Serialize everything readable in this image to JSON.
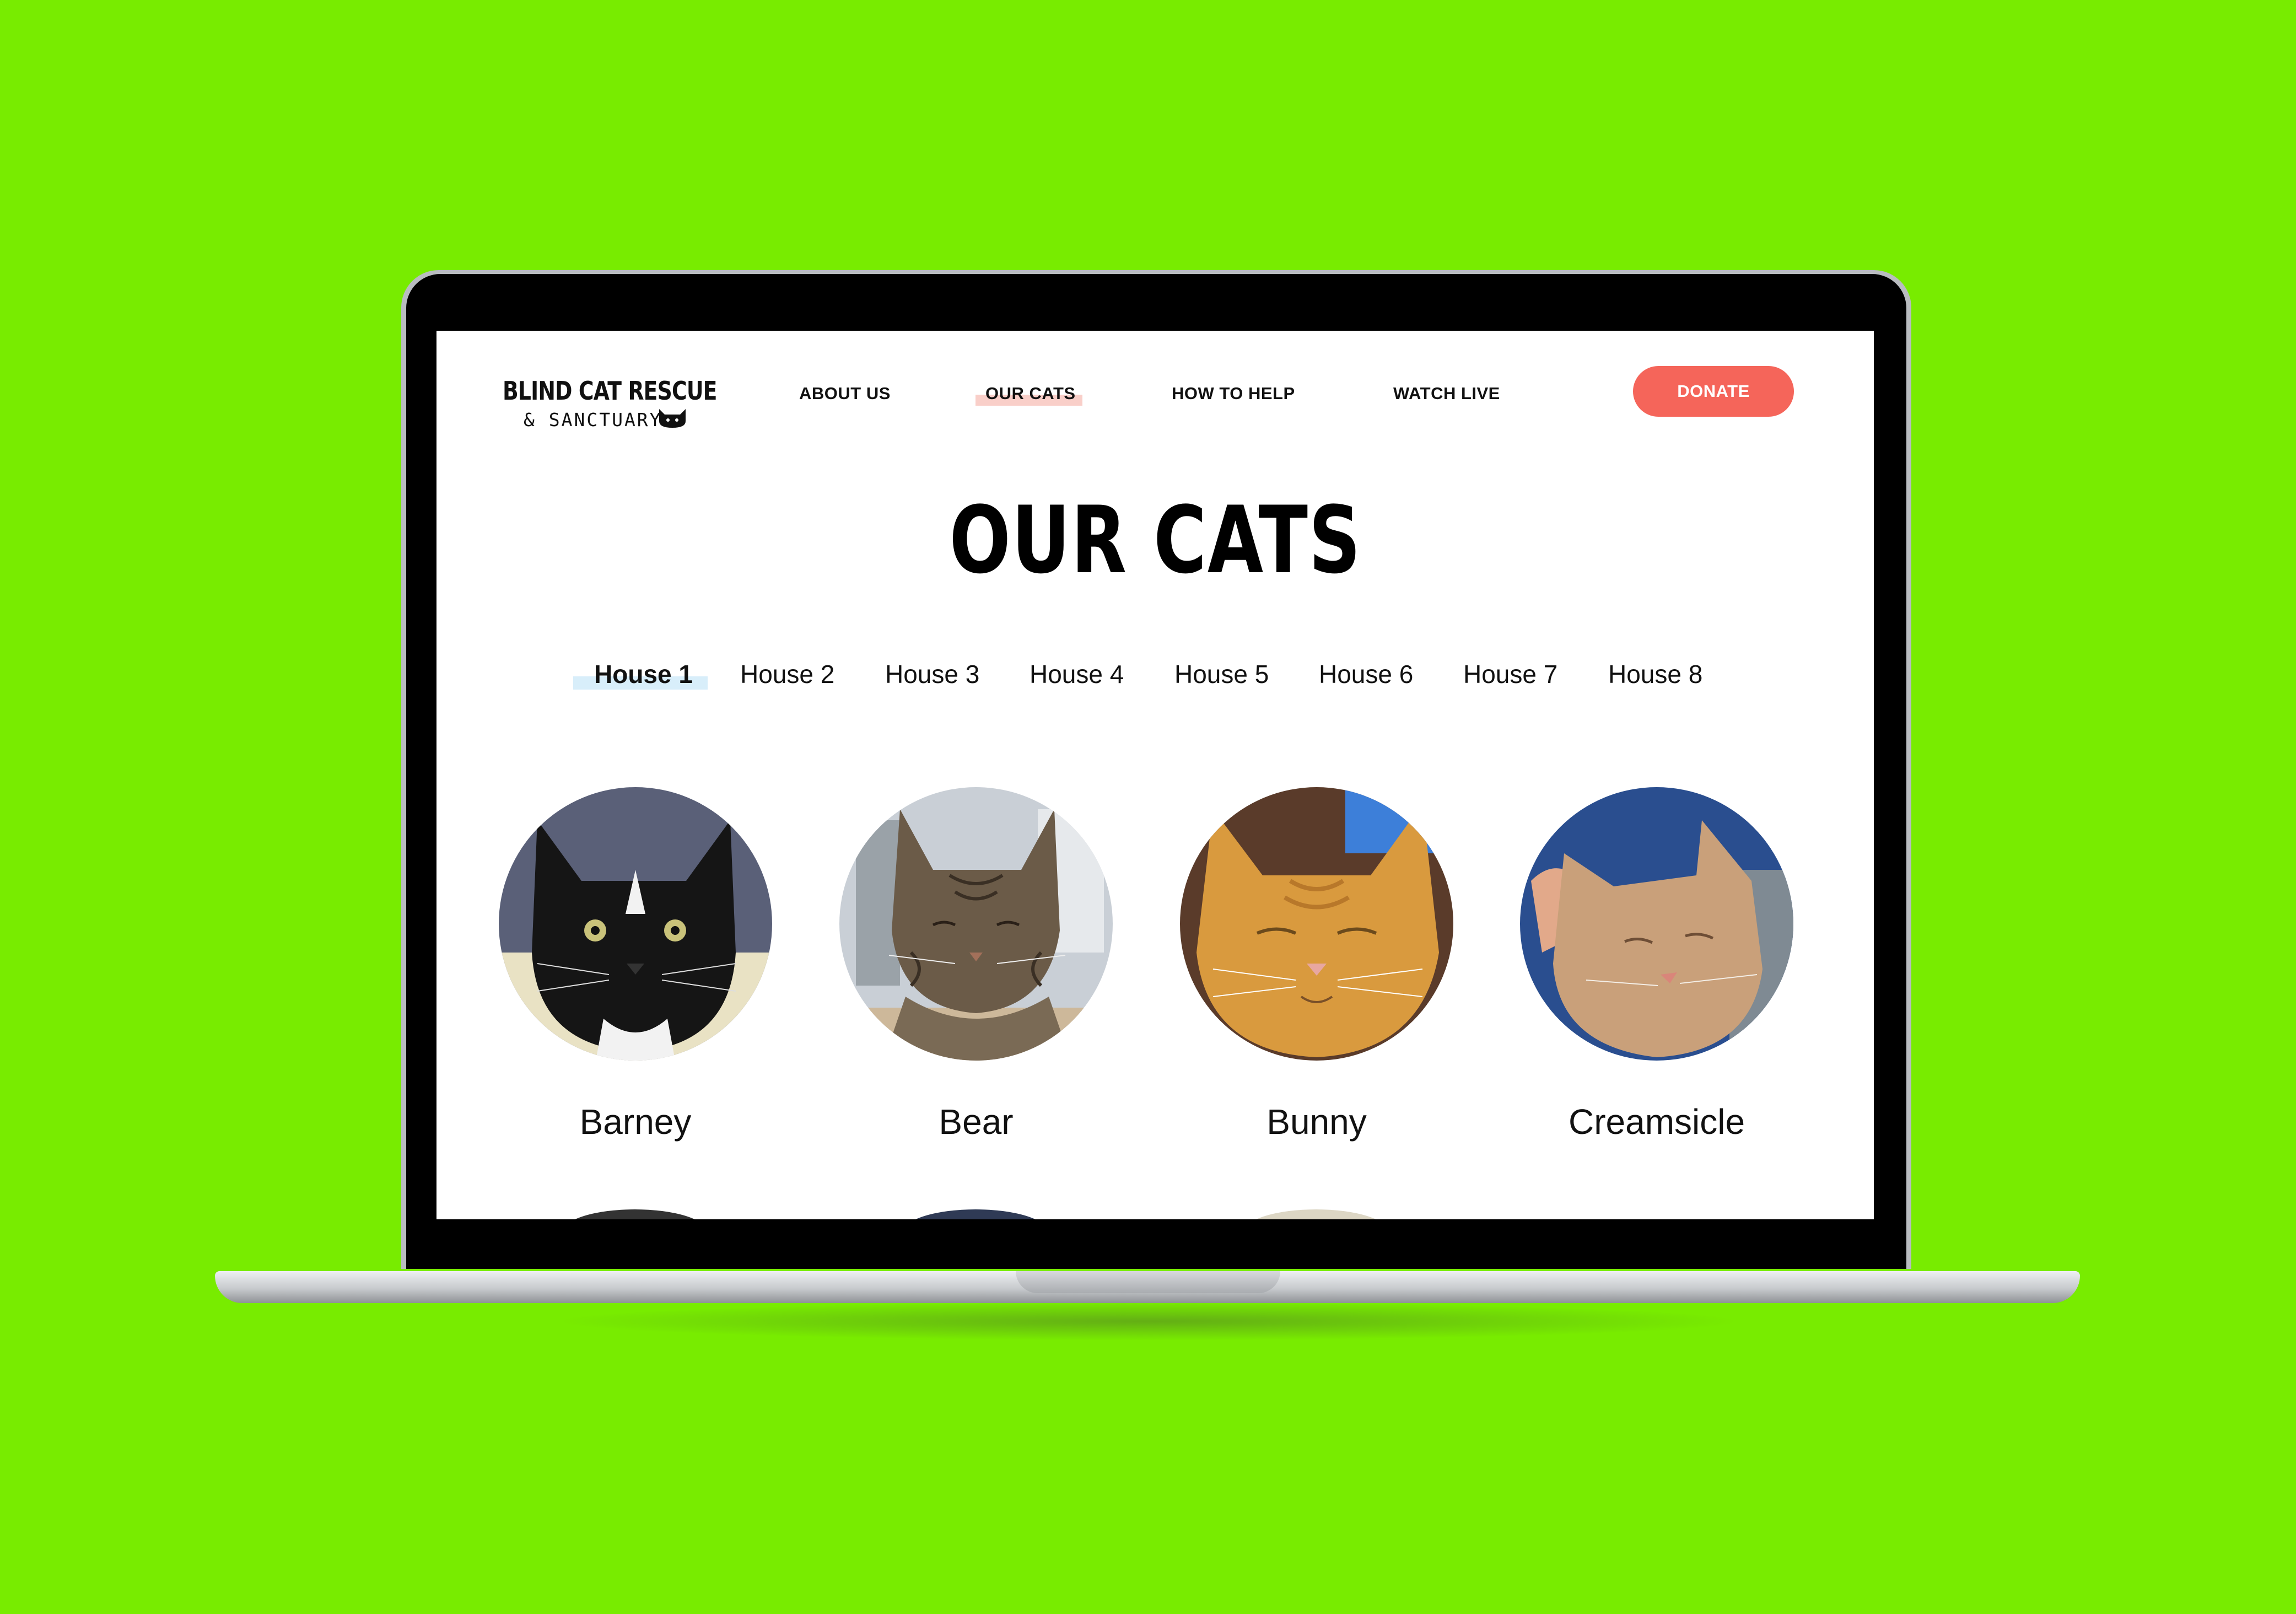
{
  "logo": {
    "title": "BLIND CAT RESCUE",
    "subtitle": "& SANCTUARY"
  },
  "nav": {
    "items": [
      {
        "label": "ABOUT US"
      },
      {
        "label": "OUR CATS"
      },
      {
        "label": "HOW TO HELP"
      },
      {
        "label": "WATCH LIVE"
      }
    ],
    "donate_label": "DONATE"
  },
  "page": {
    "title": "OUR CATS"
  },
  "tabs": [
    {
      "label": "House 1",
      "active": true
    },
    {
      "label": "House 2"
    },
    {
      "label": "House 3"
    },
    {
      "label": "House 4"
    },
    {
      "label": "House 5"
    },
    {
      "label": "House 6"
    },
    {
      "label": "House 7"
    },
    {
      "label": "House 8"
    }
  ],
  "cats": [
    {
      "name": "Barney"
    },
    {
      "name": "Bear"
    },
    {
      "name": "Bunny"
    },
    {
      "name": "Creamsicle"
    }
  ],
  "colors": {
    "background": "#78ec00",
    "donate_button": "#f5655a",
    "nav_active_highlight": "#f9cfc9",
    "tab_active_highlight": "#d8eefa"
  }
}
